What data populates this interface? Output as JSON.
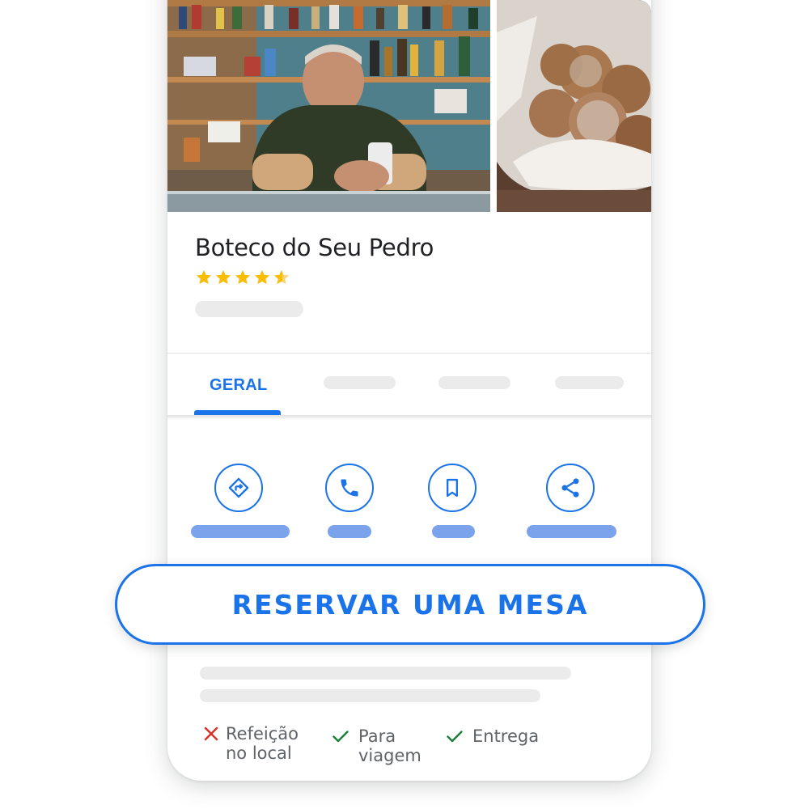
{
  "place": {
    "name": "Boteco do Seu Pedro",
    "rating_stars": 4.5
  },
  "tabs": {
    "active_label": "GERAL"
  },
  "actions": [
    {
      "icon": "directions-icon"
    },
    {
      "icon": "phone-icon"
    },
    {
      "icon": "bookmark-icon"
    },
    {
      "icon": "share-icon"
    }
  ],
  "reserve_button": {
    "label": "RESERVAR UMA MESA"
  },
  "attributes": [
    {
      "status": "unavailable",
      "icon": "close-icon",
      "line1": "Refeição",
      "line2": "no local"
    },
    {
      "status": "available",
      "icon": "check-icon",
      "line1": "Para",
      "line2": "viagem"
    },
    {
      "status": "available",
      "icon": "check-icon",
      "line1": "Entrega",
      "line2": ""
    }
  ],
  "colors": {
    "accent": "#1a73e8",
    "star": "#fbbc04",
    "unavailable": "#d93025",
    "available": "#188038"
  }
}
